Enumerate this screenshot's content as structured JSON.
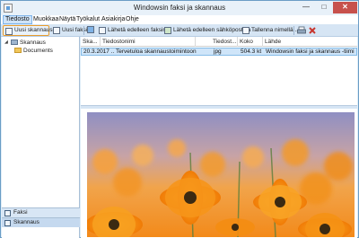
{
  "window": {
    "title": "Windowsin faksi ja skannaus"
  },
  "menu": [
    {
      "label": "Tiedosto"
    },
    {
      "label": "Muokkaa"
    },
    {
      "label": "Näytä"
    },
    {
      "label": "Työkalut"
    },
    {
      "label": "Asiakirja"
    },
    {
      "label": "Ohje"
    }
  ],
  "toolbar": {
    "new_scan": "Uusi skannaus",
    "new_fax": "Uusi faksi",
    "forward_fax": "Lähetä edelleen faksina",
    "forward_email": "Lähetä edelleen sähköpostina",
    "save_as": "Tallenna nimellä..."
  },
  "sidebar": {
    "tree_root": "Skannaus",
    "tree_child": "Documents",
    "nav_fax": "Faksi",
    "nav_scan": "Skannaus"
  },
  "list": {
    "headers": [
      "Ska...",
      "Tiedostonimi",
      "Tiedost...",
      "Koko",
      "Lähde"
    ],
    "rows": [
      [
        "20.3.2017 ...",
        "Tervetuloa skannaustoimintoon",
        "jpg",
        "504.3 kt",
        "Windowsin faksi ja skannaus -tiimi"
      ]
    ]
  },
  "preview": {
    "image": "orange-flowers-photo"
  },
  "colors": {
    "selection": "#cfe5f9",
    "highlight_border": "#e99c2c",
    "toolbar_bg": "#d6e5f4"
  }
}
